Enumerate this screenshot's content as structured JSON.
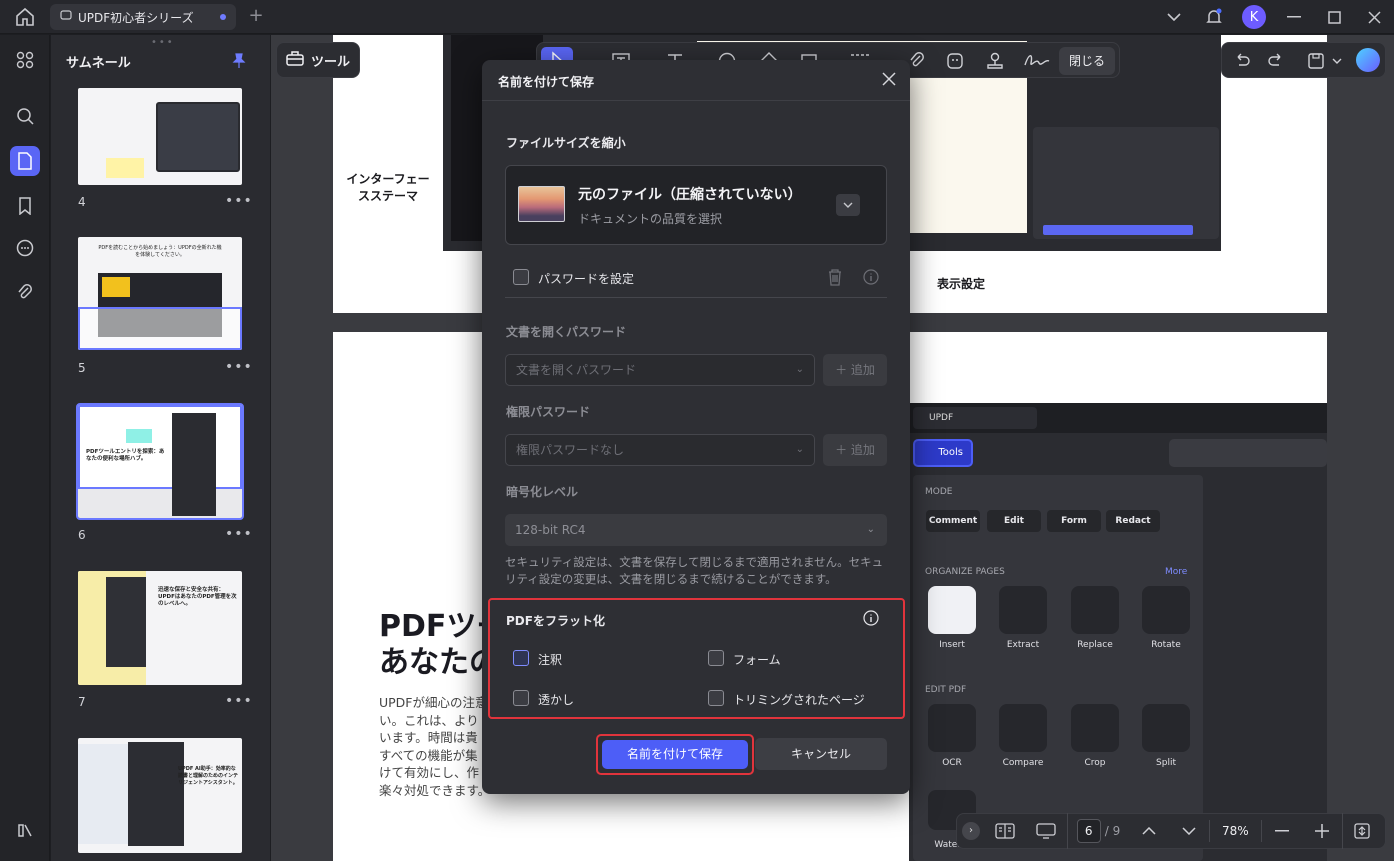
{
  "app": {
    "tab_title": "UPDF初心者シリーズ",
    "avatar_letter": "K"
  },
  "thumbnails": {
    "title": "サムネール",
    "items": [
      {
        "num": "4",
        "more": "•••"
      },
      {
        "num": "5",
        "more": "•••"
      },
      {
        "num": "6",
        "more": "•••"
      },
      {
        "num": "7",
        "more": "•••"
      }
    ],
    "thumb5_title": "PDFを読むことから始めましょう：UPDFの全新れた機を体験してください。",
    "thumb6_title": "PDFツールエントリを探索：あなたの便利な場所ハブ。",
    "thumb7_title": "迅速な保存と安全な共有：UPDFはあなたのPDF管理を次のレベルへ。",
    "thumb8_title": "UPDF AI助手：効率的な読書と理解のためのインテリジェントアシスタント。"
  },
  "toolbar": {
    "tools_label": "ツール",
    "close_label": "閉じる"
  },
  "document": {
    "label_interface": "インターフェースステーマ",
    "label_display": "表示設定",
    "heading_line1": "PDFツー",
    "heading_line2": "あなたの",
    "body_lines": [
      "UPDFが細心の注意",
      "い。これは、より",
      "います。時間は貴",
      "すべての機能が集",
      "けて有効にし、作",
      "楽々対処できます。"
    ]
  },
  "embed_panel": {
    "tab_label": "UPDF",
    "tools_label": "Tools",
    "mode_label": "MODE",
    "modes": [
      "Comment",
      "Edit",
      "Form",
      "Redact"
    ],
    "organize_label": "ORGANIZE PAGES",
    "more_label": "More",
    "organize_tiles": [
      "Insert",
      "Extract",
      "Replace",
      "Rotate"
    ],
    "edit_label": "EDIT PDF",
    "edit_tiles": [
      "OCR",
      "Compare",
      "Crop",
      "Split"
    ],
    "bottom_tile": "Waterm"
  },
  "dialog": {
    "title": "名前を付けて保存",
    "compress_section": "ファイルサイズを縮小",
    "compress_title": "元のファイル（圧縮されていない）",
    "compress_sub": "ドキュメントの品質を選択",
    "password_label": "パスワードを設定",
    "open_pw_label": "文書を開くパスワード",
    "open_pw_placeholder": "文書を開くパスワード",
    "add_label": "＋ 追加",
    "perm_pw_label": "権限パスワード",
    "perm_pw_placeholder": "権限パスワードなし",
    "encrypt_label": "暗号化レベル",
    "encrypt_value": "128-bit RC4",
    "note": "セキュリティ設定は、文書を保存して閉じるまで適用されません。セキュリティ設定の変更は、文書を閉じるまで続けることができます。",
    "flatten_title": "PDFをフラット化",
    "flatten_options": {
      "annotations": "注釈",
      "forms": "フォーム",
      "watermark": "透かし",
      "cropped": "トリミングされたページ"
    },
    "save_label": "名前を付けて保存",
    "cancel_label": "キャンセル"
  },
  "bottom_nav": {
    "current_page": "6",
    "total_pages": "/ 9",
    "zoom": "78%"
  },
  "colors": {
    "accent": "#5a66f5",
    "highlight_red": "#e1343c",
    "dialog_bg": "#2e2f34"
  }
}
